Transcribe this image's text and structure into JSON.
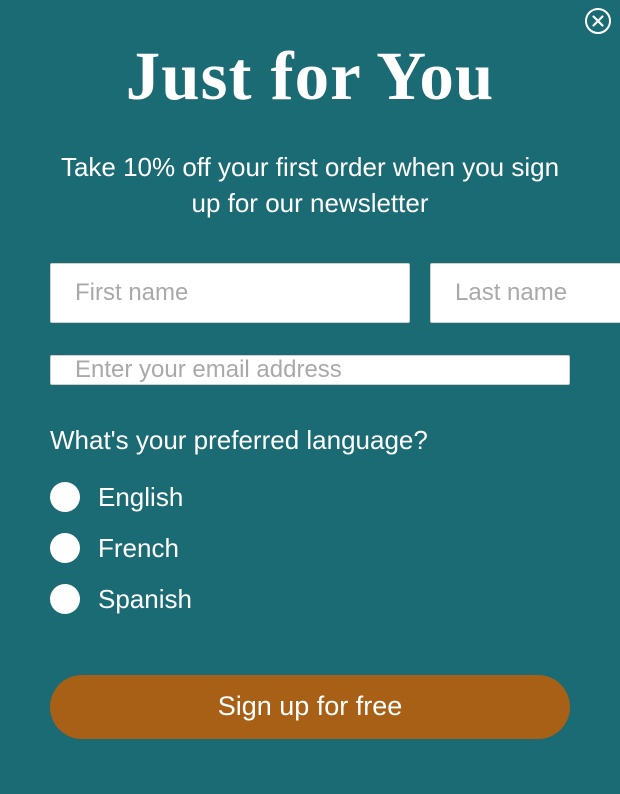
{
  "modal": {
    "title": "Just for You",
    "subtitle": "Take 10% off your first order when you sign up for our newsletter",
    "firstNamePlaceholder": "First name",
    "lastNamePlaceholder": "Last name",
    "emailPlaceholder": "Enter your email address",
    "questionLabel": "What's your preferred language?",
    "signupLabel": "Sign up for free",
    "languageOptions": [
      "English",
      "French",
      "Spanish"
    ]
  }
}
